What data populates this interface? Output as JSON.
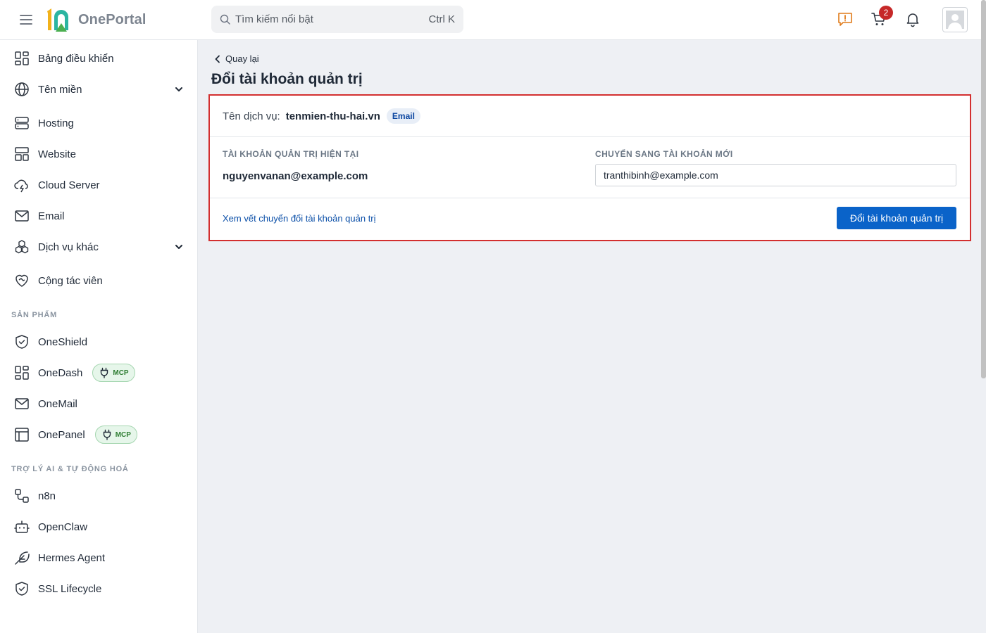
{
  "header": {
    "logo_text": "OnePortal",
    "search_placeholder": "Tìm kiếm nổi bật",
    "search_shortcut": "Ctrl K",
    "cart_count": "2"
  },
  "sidebar": {
    "items": [
      {
        "label": "Bảng điều khiển"
      },
      {
        "label": "Tên miền"
      },
      {
        "label": "Hosting"
      },
      {
        "label": "Website"
      },
      {
        "label": "Cloud Server"
      },
      {
        "label": "Email"
      },
      {
        "label": "Dịch vụ khác"
      },
      {
        "label": "Cộng tác viên"
      }
    ],
    "section_products": "SẢN PHẨM",
    "products": [
      {
        "label": "OneShield"
      },
      {
        "label": "OneDash",
        "badge": "MCP"
      },
      {
        "label": "OneMail"
      },
      {
        "label": "OnePanel",
        "badge": "MCP"
      }
    ],
    "section_ai": "TRỢ LÝ AI & TỰ ĐỘNG HOÁ",
    "ai_items": [
      {
        "label": "n8n"
      },
      {
        "label": "OpenClaw"
      },
      {
        "label": "Hermes Agent"
      },
      {
        "label": "SSL Lifecycle"
      }
    ]
  },
  "main": {
    "back_label": "Quay lại",
    "title": "Đổi tài khoản quản trị",
    "service_label": "Tên dịch vụ:",
    "service_name": "tenmien-thu-hai.vn",
    "service_type": "Email",
    "current_label": "TÀI KHOẢN QUẢN TRỊ HIỆN TẠI",
    "current_account": "nguyenvanan@example.com",
    "new_label": "CHUYỂN SANG TÀI KHOẢN MỚI",
    "new_account_value": "tranthibinh@example.com",
    "log_link": "Xem vết chuyển đổi tài khoản quản trị",
    "submit_label": "Đổi tài khoản quản trị"
  },
  "colors": {
    "accent": "#0a63c9",
    "highlight_border": "#d32f2f",
    "badge_red": "#c62828",
    "mcp_green": "#2e7d32"
  },
  "icons": {
    "menu": "hamburger-icon",
    "search": "search-icon",
    "feedback": "feedback-icon",
    "cart": "cart-icon",
    "notifications": "bell-icon",
    "user": "avatar-icon"
  }
}
